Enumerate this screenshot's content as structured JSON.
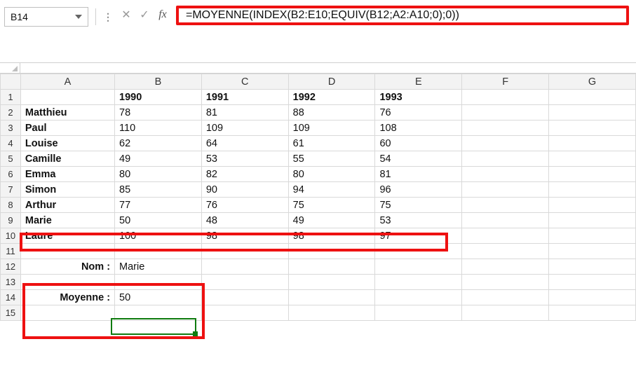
{
  "namebox": {
    "value": "B14"
  },
  "formula_bar": {
    "value": "=MOYENNE(INDEX(B2:E10;EQUIV(B12;A2:A10;0);0))"
  },
  "columns": [
    "A",
    "B",
    "C",
    "D",
    "E",
    "F",
    "G"
  ],
  "row_numbers": [
    "1",
    "2",
    "3",
    "4",
    "5",
    "6",
    "7",
    "8",
    "9",
    "10",
    "11",
    "12",
    "13",
    "14",
    "15"
  ],
  "header_row": {
    "c1990": "1990",
    "c1991": "1991",
    "c1992": "1992",
    "c1993": "1993"
  },
  "data_rows": [
    {
      "name": "Matthieu",
      "v": [
        "78",
        "81",
        "88",
        "76"
      ]
    },
    {
      "name": "Paul",
      "v": [
        "110",
        "109",
        "109",
        "108"
      ]
    },
    {
      "name": "Louise",
      "v": [
        "62",
        "64",
        "61",
        "60"
      ]
    },
    {
      "name": "Camille",
      "v": [
        "49",
        "53",
        "55",
        "54"
      ]
    },
    {
      "name": "Emma",
      "v": [
        "80",
        "82",
        "80",
        "81"
      ]
    },
    {
      "name": "Simon",
      "v": [
        "85",
        "90",
        "94",
        "96"
      ]
    },
    {
      "name": "Arthur",
      "v": [
        "77",
        "76",
        "75",
        "75"
      ]
    },
    {
      "name": "Marie",
      "v": [
        "50",
        "48",
        "49",
        "53"
      ]
    },
    {
      "name": "Laure",
      "v": [
        "100",
        "98",
        "98",
        "97"
      ]
    }
  ],
  "lookup": {
    "nom_label": "Nom :",
    "nom_value": "Marie",
    "moy_label": "Moyenne :",
    "moy_value": "50"
  },
  "chart_data": {
    "type": "table",
    "title": "",
    "categories": [
      "1990",
      "1991",
      "1992",
      "1993"
    ],
    "series": [
      {
        "name": "Matthieu",
        "values": [
          78,
          81,
          88,
          76
        ]
      },
      {
        "name": "Paul",
        "values": [
          110,
          109,
          109,
          108
        ]
      },
      {
        "name": "Louise",
        "values": [
          62,
          64,
          61,
          60
        ]
      },
      {
        "name": "Camille",
        "values": [
          49,
          53,
          55,
          54
        ]
      },
      {
        "name": "Emma",
        "values": [
          80,
          82,
          80,
          81
        ]
      },
      {
        "name": "Simon",
        "values": [
          85,
          90,
          94,
          96
        ]
      },
      {
        "name": "Arthur",
        "values": [
          77,
          76,
          75,
          75
        ]
      },
      {
        "name": "Marie",
        "values": [
          50,
          48,
          49,
          53
        ]
      },
      {
        "name": "Laure",
        "values": [
          100,
          98,
          98,
          97
        ]
      }
    ],
    "lookup_name": "Marie",
    "lookup_mean": 50
  }
}
